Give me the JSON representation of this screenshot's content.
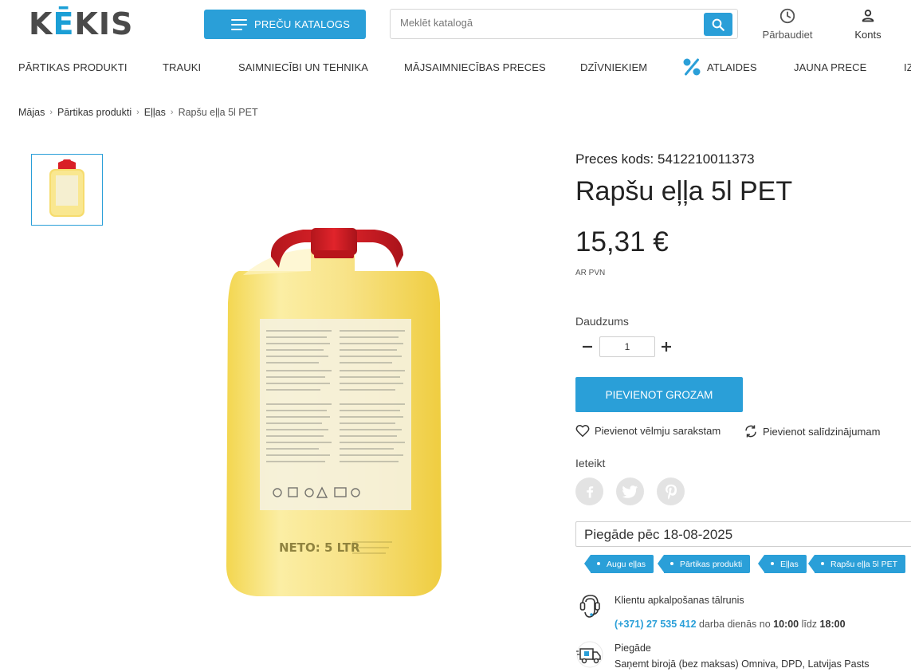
{
  "header": {
    "logo_text": "KĒKIS",
    "catalog_label": "PREČU KATALOGS",
    "search_placeholder": "Meklēt katalogā",
    "check_label": "Pārbaudiet",
    "account_label": "Konts"
  },
  "nav": {
    "items": [
      "PĀRTIKAS PRODUKTI",
      "TRAUKI",
      "SAIMNIECĪBI UN TEHNIKA",
      "MĀJSAIMNIECĪBAS PRECES",
      "DZĪVNIEKIEM",
      "ATLAIDES",
      "JAUNA PRECE",
      "IZ"
    ]
  },
  "breadcrumb": {
    "items": [
      "Mājas",
      "Pārtikas produkti",
      "Eļļas",
      "Rapšu eļļa 5l PET"
    ]
  },
  "product": {
    "sku_text": "Preces kods: 5412210011373",
    "title": "Rapšu eļļa 5l PET",
    "price": "15,31 €",
    "vat_note": "AR PVN",
    "quantity_label": "Daudzums",
    "quantity_value": "1",
    "add_to_cart_label": "PIEVIENOT GROZAM",
    "wishlist_label": "Pievienot vēlmju sarakstam",
    "compare_label": "Pievienot salīdzinājumam",
    "share_label": "Ieteikt",
    "delivery_text": "Piegāde pēc 18-08-2025",
    "bottle_label": "NETO: 5 LTR"
  },
  "tags": [
    "Augu eļļas",
    "Pārtikas produkti",
    "Eļļas",
    "Rapšu eļļa 5l PET"
  ],
  "info": {
    "support_title": "Klientu apkalpošanas tālrunis",
    "support_phone": "(+371) 27 535 412",
    "support_hours_prefix": "darba dienās no",
    "support_from": "10:00",
    "support_mid": "līdz",
    "support_to": "18:00",
    "shipping_title": "Piegāde",
    "shipping_text": "Saņemt birojā (bez maksas) Omniva, DPD, Latvijas Pasts"
  },
  "colors": {
    "accent": "#2a9fd8",
    "text": "#232323"
  }
}
